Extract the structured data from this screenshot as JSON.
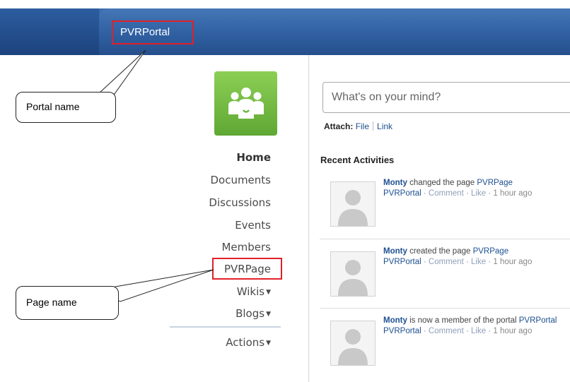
{
  "header": {
    "portal_title": "PVRPortal"
  },
  "callouts": {
    "portal_name": "Portal name",
    "page_name": "Page name"
  },
  "nav": {
    "items": [
      {
        "label": "Home"
      },
      {
        "label": "Documents"
      },
      {
        "label": "Discussions"
      },
      {
        "label": "Events"
      },
      {
        "label": "Members"
      },
      {
        "label": "PVRPage"
      },
      {
        "label": "Wikis"
      },
      {
        "label": "Blogs"
      }
    ],
    "actions": "Actions"
  },
  "composer": {
    "placeholder": "What's on your mind?",
    "attach_label": "Attach:",
    "file_link": "File",
    "link_link": "Link"
  },
  "activity": {
    "heading": "Recent Activities",
    "items": [
      {
        "user": "Monty",
        "action": "changed the page",
        "target": "PVRPage",
        "portal": "PVRPortal",
        "comment": "Comment",
        "like": "Like",
        "time": "1 hour ago"
      },
      {
        "user": "Monty",
        "action": "created the page",
        "target": "PVRPage",
        "portal": "PVRPortal",
        "comment": "Comment",
        "like": "Like",
        "time": "1 hour ago"
      },
      {
        "user": "Monty",
        "action": "is now a member of the portal",
        "target": "PVRPortal",
        "portal": "PVRPortal",
        "comment": "Comment",
        "like": "Like",
        "time": "1 hour ago"
      }
    ]
  },
  "colors": {
    "header_blue": "#3466a8",
    "logo_green": "#6cb63e",
    "highlight_red": "#e1202a",
    "link_blue": "#1d4f91"
  }
}
